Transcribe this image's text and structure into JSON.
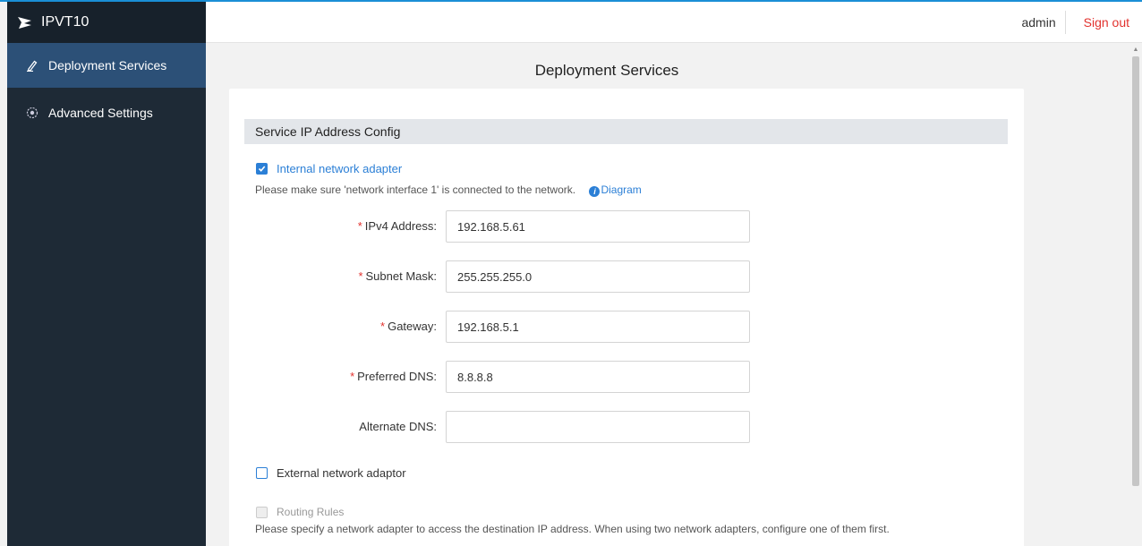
{
  "app": {
    "title": "IPVT10"
  },
  "header": {
    "user": "admin",
    "signout": "Sign out"
  },
  "sidebar": {
    "items": [
      {
        "label": "Deployment Services",
        "active": true
      },
      {
        "label": "Advanced Settings",
        "active": false
      }
    ]
  },
  "page": {
    "title": "Deployment Services"
  },
  "section": {
    "title": "Service IP Address Config"
  },
  "internal_adapter": {
    "label": "Internal network adapter",
    "checked": true,
    "note": "Please make sure 'network interface 1' is connected to the network.",
    "diagram_link": "Diagram"
  },
  "fields": {
    "ipv4": {
      "label": "IPv4 Address:",
      "value": "192.168.5.61",
      "required": "*"
    },
    "subnet": {
      "label": "Subnet Mask:",
      "value": "255.255.255.0",
      "required": "*"
    },
    "gateway": {
      "label": "Gateway:",
      "value": "192.168.5.1",
      "required": "*"
    },
    "preferred_dns": {
      "label": "Preferred DNS:",
      "value": "8.8.8.8",
      "required": "*"
    },
    "alternate_dns": {
      "label": "Alternate DNS:",
      "value": ""
    }
  },
  "external_adapter": {
    "label": "External network adaptor",
    "checked": false
  },
  "routing": {
    "label": "Routing Rules",
    "note": "Please specify a network adapter to access the destination IP address. When using two network adapters, configure one of them first."
  },
  "colors": {
    "accent": "#2b7fd6",
    "sidebar": "#1e2a36",
    "active_item": "#2c5077",
    "danger": "#e2322e"
  }
}
